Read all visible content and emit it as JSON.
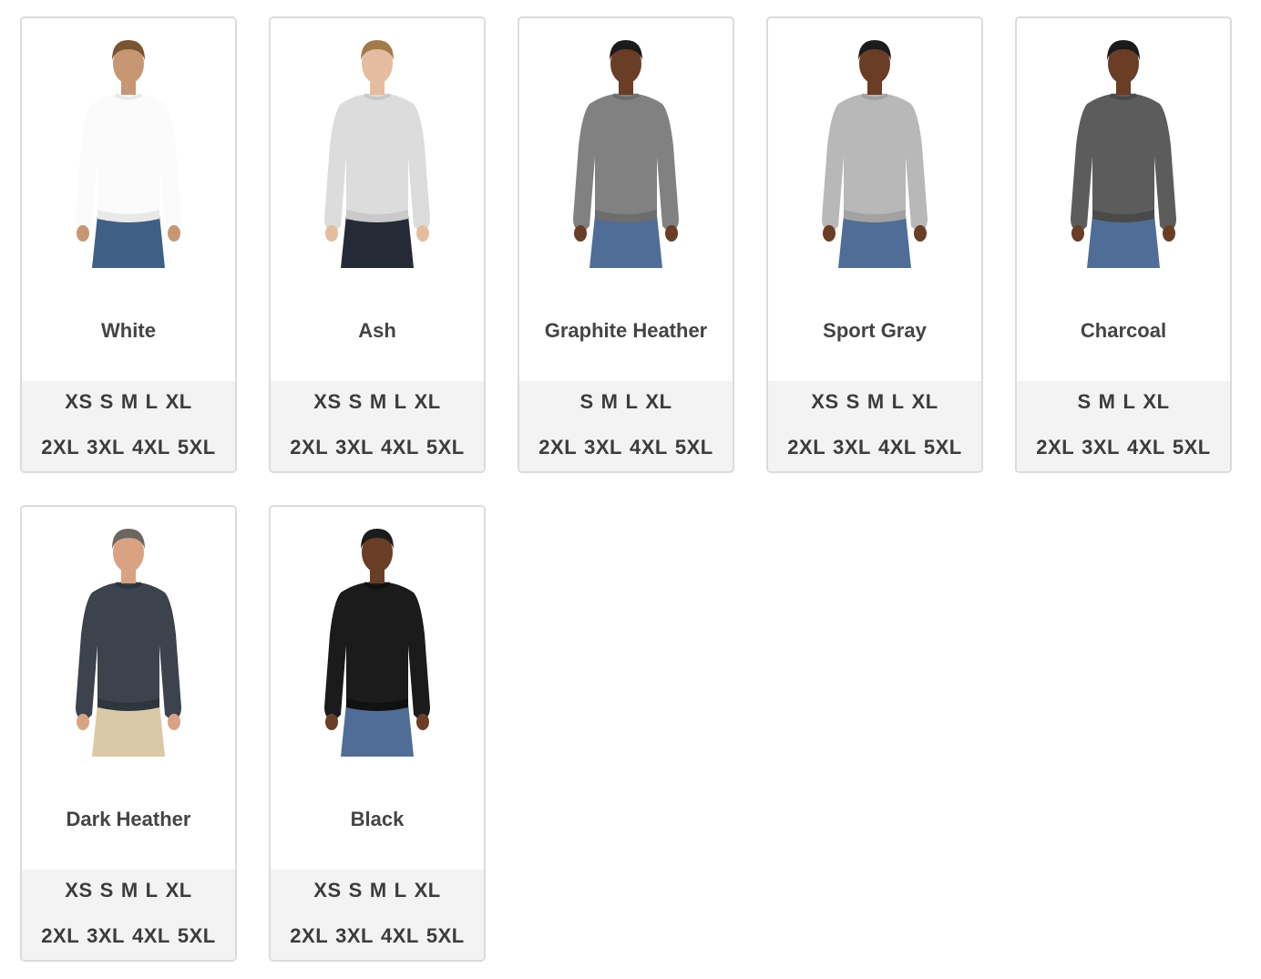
{
  "products": [
    {
      "color": "White",
      "shirt": "#fbfbfb",
      "trim": "#e9e9e9",
      "pants": "#3f5f86",
      "skin": "#c79774",
      "hair": "#7a5330",
      "row1": [
        "XS",
        "S",
        "M",
        "L",
        "XL"
      ],
      "row2": [
        "2XL",
        "3XL",
        "4XL",
        "5XL"
      ]
    },
    {
      "color": "Ash",
      "shirt": "#dcdcdc",
      "trim": "#c9c9c9",
      "pants": "#262a36",
      "skin": "#e4bda0",
      "hair": "#a27a4a",
      "row1": [
        "XS",
        "S",
        "M",
        "L",
        "XL"
      ],
      "row2": [
        "2XL",
        "3XL",
        "4XL",
        "5XL"
      ]
    },
    {
      "color": "Graphite Heather",
      "shirt": "#818181",
      "trim": "#6d6d6d",
      "pants": "#4f6d96",
      "skin": "#6a3d26",
      "hair": "#1b1b1b",
      "row1": [
        "S",
        "M",
        "L",
        "XL"
      ],
      "row2": [
        "2XL",
        "3XL",
        "4XL",
        "5XL"
      ]
    },
    {
      "color": "Sport Gray",
      "shirt": "#b8b8b8",
      "trim": "#a2a2a2",
      "pants": "#4f6d96",
      "skin": "#6a3d26",
      "hair": "#1b1b1b",
      "row1": [
        "XS",
        "S",
        "M",
        "L",
        "XL"
      ],
      "row2": [
        "2XL",
        "3XL",
        "4XL",
        "5XL"
      ]
    },
    {
      "color": "Charcoal",
      "shirt": "#5c5c5c",
      "trim": "#4a4a4a",
      "pants": "#4f6d96",
      "skin": "#6a3d26",
      "hair": "#1b1b1b",
      "row1": [
        "S",
        "M",
        "L",
        "XL"
      ],
      "row2": [
        "2XL",
        "3XL",
        "4XL",
        "5XL"
      ]
    },
    {
      "color": "Dark Heather",
      "shirt": "#3c434d",
      "trim": "#2f353d",
      "pants": "#d9c9a7",
      "skin": "#d9a383",
      "hair": "#6c6660",
      "row1": [
        "XS",
        "S",
        "M",
        "L",
        "XL"
      ],
      "row2": [
        "2XL",
        "3XL",
        "4XL",
        "5XL"
      ]
    },
    {
      "color": "Black",
      "shirt": "#1b1b1b",
      "trim": "#111111",
      "pants": "#4f6d96",
      "skin": "#6a3d26",
      "hair": "#1b1b1b",
      "row1": [
        "XS",
        "S",
        "M",
        "L",
        "XL"
      ],
      "row2": [
        "2XL",
        "3XL",
        "4XL",
        "5XL"
      ]
    }
  ]
}
